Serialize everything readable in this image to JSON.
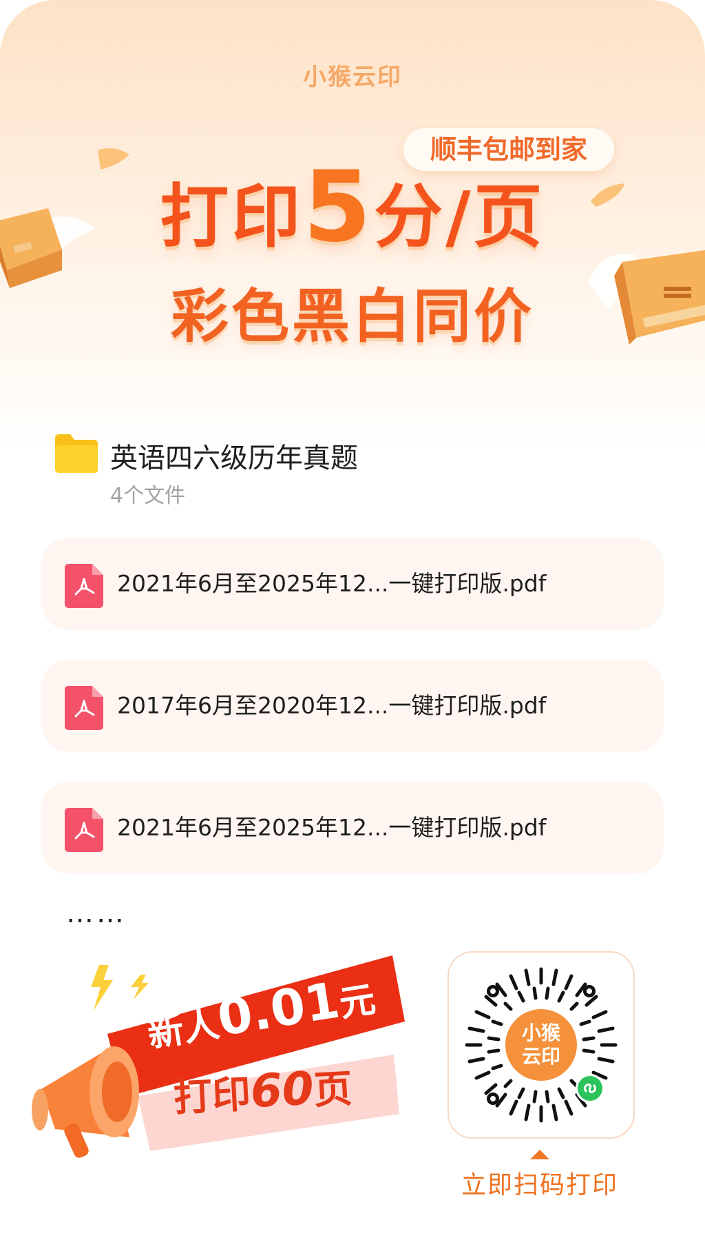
{
  "brand": {
    "name": "小猴云印",
    "accent": "#f6a866"
  },
  "hero": {
    "badge": "顺丰包邮到家",
    "headline_prefix": "打印",
    "headline_number": "5",
    "headline_suffix": "分/页",
    "subline": "彩色黑白同价",
    "primary_color": "#f4541c"
  },
  "folder": {
    "icon": "folder-icon",
    "title": "英语四六级历年真题",
    "count": "4个文件"
  },
  "files": [
    {
      "icon": "pdf-icon",
      "name": "2021年6月至2025年12...一键打印版.pdf"
    },
    {
      "icon": "pdf-icon",
      "name": "2017年6月至2020年12...一键打印版.pdf"
    },
    {
      "icon": "pdf-icon",
      "name": "2021年6月至2025年12...一键打印版.pdf"
    }
  ],
  "more": "……",
  "promo": {
    "line1_prefix": "新人",
    "line1_amount": "0.01",
    "line1_unit": "元",
    "line2_prefix": "打印",
    "line2_amount": "60",
    "line2_unit": "页",
    "red": "#ea2f14",
    "pink": "#fdd6d1"
  },
  "qr": {
    "logo_top": "小猴",
    "logo_bottom": "云印",
    "badge_icon": "mini-program-icon"
  },
  "scan_label": "立即扫码打印"
}
